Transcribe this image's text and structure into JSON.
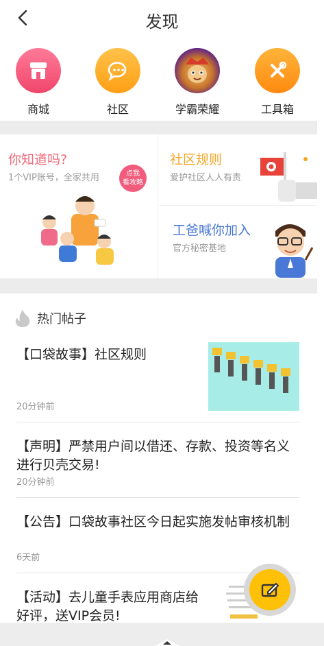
{
  "header": {
    "title": "发现"
  },
  "quick_entries": [
    {
      "label": "商城",
      "icon": "shop-icon"
    },
    {
      "label": "社区",
      "icon": "chat-icon"
    },
    {
      "label": "学霸荣耀",
      "icon": "game-avatar-icon"
    },
    {
      "label": "工具箱",
      "icon": "tools-icon"
    }
  ],
  "cards": {
    "know": {
      "title": "你知道吗?",
      "subtitle": "1个VIP账号，全家共用",
      "badge_line1": "点我",
      "badge_line2": "看攻略"
    },
    "rules": {
      "title": "社区规则",
      "subtitle": "爱护社区人人有责"
    },
    "join": {
      "title": "工爸喊你加入",
      "subtitle": "官方秘密基地"
    }
  },
  "hot": {
    "title": "热门帖子"
  },
  "posts": [
    {
      "title": "【口袋故事】社区规则",
      "time": "20分钟前"
    },
    {
      "title": "【声明】严禁用户间以借还、存款、投资等名义进行贝壳交易!",
      "time": "20分钟前"
    },
    {
      "title": "【公告】口袋故事社区今日起实施发帖审核机制",
      "time": "6天前"
    },
    {
      "title": "【活动】去儿童手表应用商店给好评，送VIP会员!",
      "time": ""
    }
  ],
  "colors": {
    "shop": "#f25c7c",
    "community": "#ffad20",
    "tools": "#ff9a16",
    "rules": "#f5a623",
    "join": "#4a78d6",
    "know": "#f0697a",
    "fab": "#ffc107"
  }
}
